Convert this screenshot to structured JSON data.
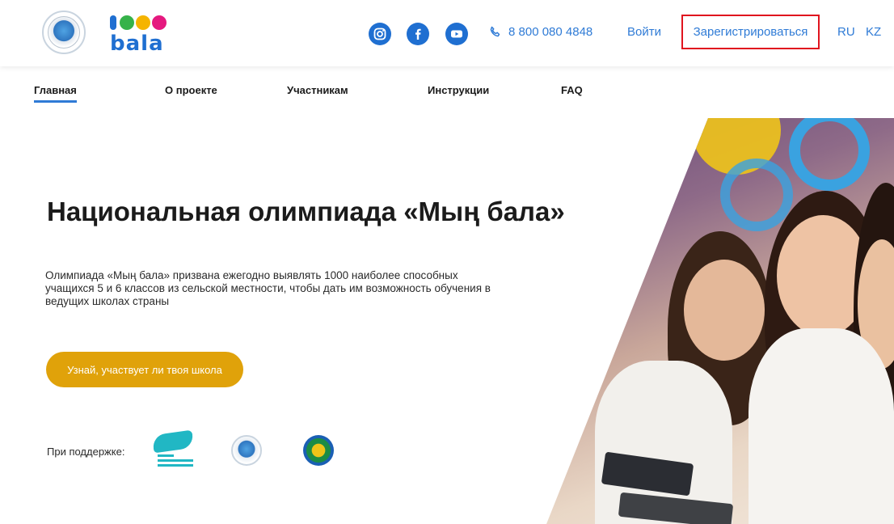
{
  "header": {
    "phone": "8 800 080 4848",
    "login_label": "Войти",
    "register_label": "Зарегистрироваться",
    "lang_ru": "RU",
    "lang_kz": "KZ",
    "logo_1000_text": "bala",
    "social": {
      "instagram_icon": "instagram-icon",
      "facebook_icon": "facebook-icon",
      "youtube_icon": "youtube-icon"
    }
  },
  "nav": {
    "items": [
      {
        "label": "Главная"
      },
      {
        "label": "О проекте"
      },
      {
        "label": "Участникам"
      },
      {
        "label": "Инструкции"
      },
      {
        "label": "FAQ"
      }
    ],
    "active_index": 0
  },
  "hero": {
    "title": "Национальная олимпиада «Мың бала»",
    "description": "Олимпиада «Мың бала» призвана ежегодно выявлять 1000 наиболее способных учащихся 5 и 6 классов из сельской местности, чтобы дать им возможность обучения в ведущих школах страны",
    "cta_label": "Узнай, участвует ли твоя школа"
  },
  "support": {
    "label": "При поддержке:"
  },
  "colors": {
    "accent_blue": "#2f7bd6",
    "cta_gold": "#e0a20a",
    "highlight_red": "#e0141e",
    "social_blue": "#1f6fd1"
  }
}
